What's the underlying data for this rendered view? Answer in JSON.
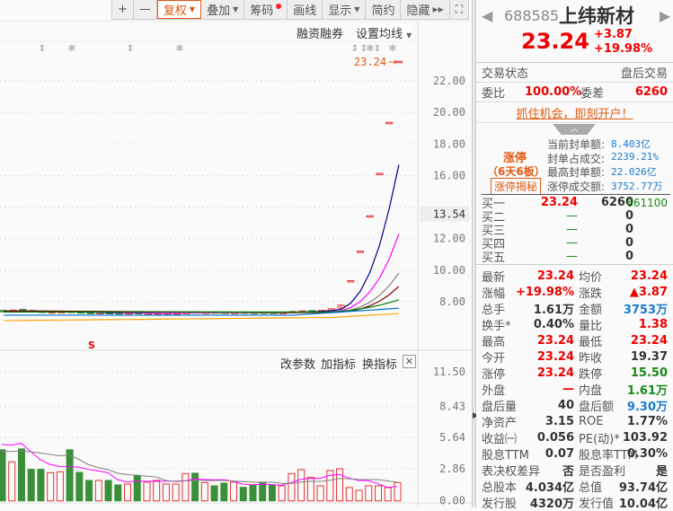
{
  "toolbar": {
    "zoom_in": "+",
    "zoom_out": "—",
    "restore_rights": "复权",
    "overlay": "叠加",
    "chips": "筹码",
    "draw": "画线",
    "display": "显示",
    "simple": "简约",
    "hide": "隐藏"
  },
  "chart_header": {
    "margin": "融资融券",
    "ma_settings": "设置均线"
  },
  "price_label": "23.24",
  "price_axis": [
    "22.00",
    "20.00",
    "18.00",
    "16.00",
    "12.00",
    "10.00",
    "8.00"
  ],
  "cursor_price": "13.54",
  "marker_s": "S",
  "indicator_toolbar": {
    "edit_params": "改参数",
    "add_indicator": "加指标",
    "change_indicator": "换指标"
  },
  "volume_axis": [
    "11.50",
    "8.43",
    "5.64",
    "2.86",
    "0.00"
  ],
  "colors": {
    "up": "#e83030",
    "down": "#3a8f3a",
    "ma5": "#000080",
    "ma10": "#ff00ff",
    "ma20": "#808080",
    "ma30": "#800000",
    "ma60": "#008000",
    "ma120": "#0070d0",
    "ma250": "#ffa500"
  },
  "chart_data": {
    "type": "candlestick",
    "price_ylim": [
      6.3,
      23.5
    ],
    "candles": [
      {
        "o": 7.45,
        "c": 7.42,
        "h": 7.5,
        "l": 7.38
      },
      {
        "o": 7.4,
        "c": 7.47,
        "h": 7.5,
        "l": 7.38
      },
      {
        "o": 7.52,
        "c": 7.42,
        "h": 7.55,
        "l": 7.38
      },
      {
        "o": 7.45,
        "c": 7.38,
        "h": 7.48,
        "l": 7.33
      },
      {
        "o": 7.4,
        "c": 7.35,
        "h": 7.43,
        "l": 7.3
      },
      {
        "o": 7.32,
        "c": 7.37,
        "h": 7.42,
        "l": 7.3
      },
      {
        "o": 7.33,
        "c": 7.38,
        "h": 7.42,
        "l": 7.3
      },
      {
        "o": 7.4,
        "c": 7.32,
        "h": 7.45,
        "l": 7.28
      },
      {
        "o": 7.36,
        "c": 7.3,
        "h": 7.4,
        "l": 7.27
      },
      {
        "o": 7.33,
        "c": 7.3,
        "h": 7.36,
        "l": 7.26
      },
      {
        "o": 7.3,
        "c": 7.32,
        "h": 7.35,
        "l": 7.25
      },
      {
        "o": 7.32,
        "c": 7.3,
        "h": 7.34,
        "l": 7.27
      },
      {
        "o": 7.3,
        "c": 7.28,
        "h": 7.32,
        "l": 7.24
      },
      {
        "o": 7.26,
        "c": 7.3,
        "h": 7.33,
        "l": 7.24
      },
      {
        "o": 7.32,
        "c": 7.27,
        "h": 7.35,
        "l": 7.22
      },
      {
        "o": 7.25,
        "c": 7.28,
        "h": 7.3,
        "l": 7.22
      },
      {
        "o": 7.24,
        "c": 7.28,
        "h": 7.3,
        "l": 7.2
      },
      {
        "o": 7.23,
        "c": 7.27,
        "h": 7.3,
        "l": 7.2
      },
      {
        "o": 7.25,
        "c": 7.29,
        "h": 7.32,
        "l": 7.22
      },
      {
        "o": 7.27,
        "c": 7.33,
        "h": 7.36,
        "l": 7.25
      },
      {
        "o": 7.36,
        "c": 7.3,
        "h": 7.38,
        "l": 7.28
      },
      {
        "o": 7.3,
        "c": 7.34,
        "h": 7.36,
        "l": 7.28
      },
      {
        "o": 7.36,
        "c": 7.32,
        "h": 7.38,
        "l": 7.3
      },
      {
        "o": 7.34,
        "c": 7.3,
        "h": 7.36,
        "l": 7.28
      },
      {
        "o": 7.3,
        "c": 7.33,
        "h": 7.35,
        "l": 7.28
      },
      {
        "o": 7.35,
        "c": 7.31,
        "h": 7.37,
        "l": 7.29
      },
      {
        "o": 7.33,
        "c": 7.3,
        "h": 7.35,
        "l": 7.28
      },
      {
        "o": 7.34,
        "c": 7.31,
        "h": 7.36,
        "l": 7.29
      },
      {
        "o": 7.33,
        "c": 7.3,
        "h": 7.35,
        "l": 7.28
      },
      {
        "o": 7.3,
        "c": 7.33,
        "h": 7.36,
        "l": 7.28
      },
      {
        "o": 7.32,
        "c": 7.38,
        "h": 7.42,
        "l": 7.3
      },
      {
        "o": 7.36,
        "c": 7.42,
        "h": 7.45,
        "l": 7.34
      },
      {
        "o": 7.44,
        "c": 7.4,
        "h": 7.46,
        "l": 7.36
      },
      {
        "o": 7.4,
        "c": 7.45,
        "h": 7.48,
        "l": 7.38
      },
      {
        "o": 7.42,
        "c": 7.55,
        "h": 7.6,
        "l": 7.4
      },
      {
        "o": 7.6,
        "c": 7.78,
        "h": 7.83,
        "l": 7.58
      },
      {
        "o": 9.34,
        "c": 9.34,
        "h": 9.34,
        "l": 9.34
      },
      {
        "o": 11.21,
        "c": 11.21,
        "h": 11.21,
        "l": 11.21
      },
      {
        "o": 13.45,
        "c": 13.45,
        "h": 13.45,
        "l": 13.45
      },
      {
        "o": 16.14,
        "c": 16.14,
        "h": 16.14,
        "l": 16.14
      },
      {
        "o": 19.37,
        "c": 19.37,
        "h": 19.37,
        "l": 19.37
      },
      {
        "o": 23.24,
        "c": 23.24,
        "h": 23.24,
        "l": 23.24
      }
    ],
    "volume": [
      4.55,
      3.48,
      4.63,
      2.81,
      2.81,
      2.51,
      2.59,
      4.55,
      2.54,
      1.82,
      1.82,
      1.82,
      1.42,
      1.5,
      2.27,
      1.68,
      1.82,
      1.5,
      1.5,
      2.43,
      2.46,
      1.63,
      1.34,
      1.58,
      1.68,
      1.2,
      1.39,
      1.6,
      1.39,
      1.34,
      2.43,
      2.78,
      2.09,
      1.34,
      2.7,
      2.86,
      1.18,
      0.94,
      1.34,
      1.34,
      1.18,
      1.63
    ],
    "volume_up": [
      false,
      true,
      false,
      false,
      false,
      true,
      true,
      false,
      false,
      false,
      true,
      false,
      false,
      true,
      false,
      true,
      true,
      true,
      true,
      true,
      false,
      true,
      false,
      false,
      true,
      false,
      false,
      false,
      false,
      true,
      true,
      true,
      true,
      true,
      true,
      true,
      true,
      true,
      true,
      true,
      true,
      true
    ],
    "volume_ylim": [
      0,
      11.5
    ],
    "ma_base": {
      "ma60": 7.35,
      "ma120": 7.15,
      "ma250": 6.8
    }
  },
  "quote": {
    "code": "688585",
    "name": "上纬新材",
    "price": "23.24",
    "change": "+3.87",
    "change_pct": "+19.98%"
  },
  "status": {
    "label": "交易状态",
    "value": "盘后交易"
  },
  "bid_ratio": {
    "label1": "委比",
    "value1": "100.00%",
    "label2": "委差",
    "value2": "6260"
  },
  "promo": "抓住机会，即刻开户！",
  "limit_up": {
    "title": "涨停",
    "days": "（6天6板）",
    "reveal": "涨停揭秘",
    "rows": [
      {
        "k": "当前封单额:",
        "v": "8.403亿"
      },
      {
        "k": "封单占成交:",
        "v": "2239.21%"
      },
      {
        "k": "最高封单额:",
        "v": "22.026亿"
      },
      {
        "k": "涨停成交额:",
        "v": "3752.77万"
      }
    ]
  },
  "bids": [
    {
      "k": "买一",
      "p": "23.24",
      "v": "6260",
      "extra": "661100"
    },
    {
      "k": "买二",
      "p": "—",
      "v": "0"
    },
    {
      "k": "买三",
      "p": "—",
      "v": "0"
    },
    {
      "k": "买四",
      "p": "—",
      "v": "0"
    },
    {
      "k": "买五",
      "p": "—",
      "v": "0"
    }
  ],
  "stats": [
    {
      "k1": "最新",
      "v1": "23.24",
      "c1": "red",
      "k2": "均价",
      "v2": "23.24",
      "c2": "red"
    },
    {
      "k1": "涨幅",
      "v1": "+19.98%",
      "c1": "red",
      "k2": "涨跌",
      "v2": "▲3.87",
      "c2": "red"
    },
    {
      "k1": "总手",
      "v1": "1.61万",
      "c1": "dark",
      "k2": "金额",
      "v2": "3753万",
      "c2": "blue"
    },
    {
      "k1": "换手*",
      "v1": "0.40%",
      "c1": "dark",
      "k2": "量比",
      "v2": "1.38",
      "c2": "red"
    },
    {
      "k1": "最高",
      "v1": "23.24",
      "c1": "red",
      "k2": "最低",
      "v2": "23.24",
      "c2": "red"
    },
    {
      "k1": "今开",
      "v1": "23.24",
      "c1": "red",
      "k2": "昨收",
      "v2": "19.37",
      "c2": "dark"
    },
    {
      "k1": "涨停",
      "v1": "23.24",
      "c1": "red",
      "k2": "跌停",
      "v2": "15.50",
      "c2": "green"
    },
    {
      "k1": "外盘",
      "v1": "—",
      "c1": "red",
      "k2": "内盘",
      "v2": "1.61万",
      "c2": "green"
    },
    {
      "k1": "盘后量",
      "v1": "40",
      "c1": "dark",
      "k2": "盘后额",
      "v2": "9.30万",
      "c2": "blue"
    },
    {
      "k1": "净资产",
      "v1": "3.15",
      "c1": "dark",
      "k2": "ROE",
      "v2": "1.77%",
      "c2": "dark"
    },
    {
      "k1": "收益㈠",
      "v1": "0.056",
      "c1": "dark",
      "k2": "PE(动)*",
      "v2": "103.92",
      "c2": "dark"
    },
    {
      "k1": "股息TTM",
      "v1": "0.07",
      "c1": "dark",
      "k2": "股息率TTM",
      "v2": "0.30%",
      "c2": "dark"
    },
    {
      "k1": "表决权差异",
      "v1": "否",
      "c1": "dark",
      "k2": "是否盈利",
      "v2": "是",
      "c2": "dark"
    },
    {
      "k1": "总股本",
      "v1": "4.034亿",
      "c1": "dark",
      "k2": "总值",
      "v2": "93.74亿",
      "c2": "dark"
    },
    {
      "k1": "发行股",
      "v1": "4320万",
      "c1": "dark",
      "k2": "发行值",
      "v2": "10.04亿",
      "c2": "dark"
    }
  ]
}
